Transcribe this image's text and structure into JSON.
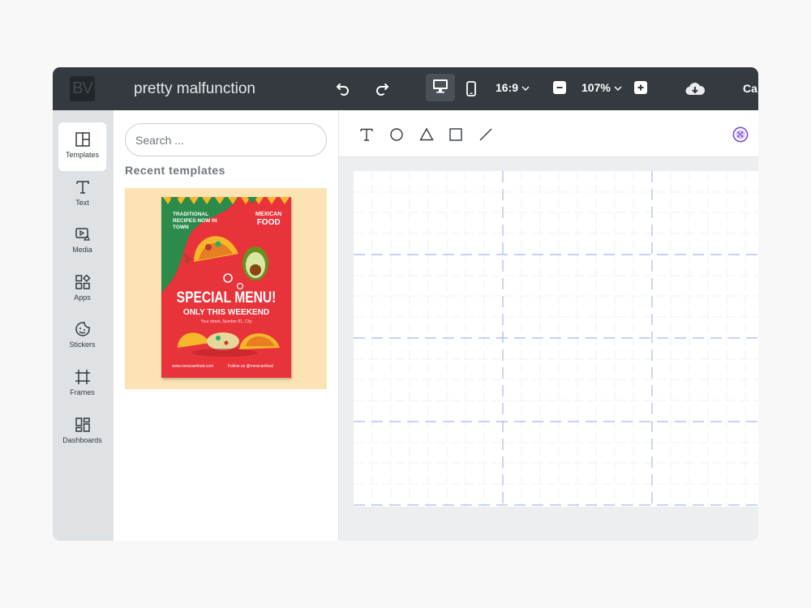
{
  "app": {
    "logo_text": "BV",
    "project_title": "pretty malfunction",
    "cut_off_text": "Ca"
  },
  "header": {
    "aspect_ratio": "16:9",
    "zoom": "107%",
    "icons": [
      "undo-icon",
      "redo-icon",
      "desktop-icon",
      "mobile-icon",
      "minus-icon",
      "plus-icon",
      "cloud-download-icon"
    ]
  },
  "sidebar": {
    "items": [
      {
        "label": "Templates",
        "icon": "templates-icon",
        "active": true
      },
      {
        "label": "Text",
        "icon": "text-icon",
        "active": false
      },
      {
        "label": "Media",
        "icon": "media-icon",
        "active": false
      },
      {
        "label": "Apps",
        "icon": "apps-icon",
        "active": false
      },
      {
        "label": "Stickers",
        "icon": "stickers-icon",
        "active": false
      },
      {
        "label": "Frames",
        "icon": "frames-icon",
        "active": false
      },
      {
        "label": "Dashboards",
        "icon": "dashboards-icon",
        "active": false
      }
    ]
  },
  "templates_panel": {
    "search_placeholder": "Search ...",
    "section_title": "Recent templates",
    "template": {
      "headline_small": "TRADITIONAL RECIPES NOW IN TOWN",
      "brand_top": "MEXICAN",
      "brand_bottom": "FOOD",
      "headline": "SPECIAL MENU!",
      "subheadline": "ONLY THIS WEEKEND",
      "address": "Your street, Number 81, City",
      "website": "www.mexicanfood.com",
      "social": "Follow us @mexicanfood"
    }
  },
  "canvas_tools": {
    "icons": [
      "text-tool-icon",
      "circle-tool-icon",
      "triangle-tool-icon",
      "rectangle-tool-icon",
      "line-tool-icon",
      "color-palette-icon"
    ]
  },
  "colors": {
    "topbar": "#353a40",
    "rail": "#dfe2e5",
    "poster_red": "#e8333a",
    "poster_green": "#2c8a4a",
    "template_bg": "#fce3b4",
    "guide_blue": "#a9b8ee",
    "palette_purple": "#7b4fd6"
  }
}
